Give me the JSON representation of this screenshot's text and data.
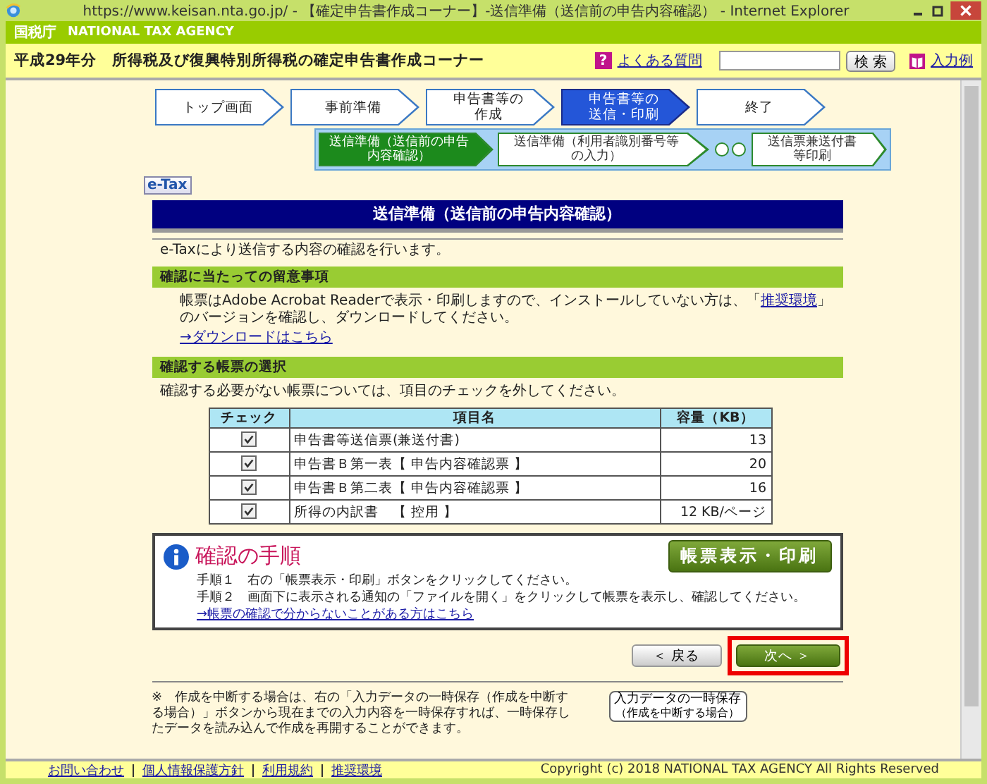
{
  "window": {
    "title": "https://www.keisan.nta.go.jp/ - 【確定申告書作成コーナー】-送信準備（送信前の申告内容確認） - Internet Explorer"
  },
  "agency": {
    "logo": "国税庁",
    "name": "NATIONAL TAX AGENCY"
  },
  "header": {
    "title": "平成29年分　所得税及び復興特別所得税の確定申告書作成コーナー",
    "faq_icon": "?",
    "faq_link": "よくある質問",
    "search_button": "検 索",
    "example_link": "入力例"
  },
  "steps": [
    {
      "lines": [
        "トップ画面"
      ],
      "selected": false
    },
    {
      "lines": [
        "事前準備"
      ],
      "selected": false
    },
    {
      "lines": [
        "申告書等の",
        "作成"
      ],
      "selected": false
    },
    {
      "lines": [
        "申告書等の",
        "送信・印刷"
      ],
      "selected": true
    },
    {
      "lines": [
        "終了"
      ],
      "selected": false
    }
  ],
  "substeps": [
    {
      "lines": [
        "送信準備（送信前の申告",
        "内容確認）"
      ],
      "selected": true
    },
    {
      "lines": [
        "送信準備（利用者識別番号等",
        "の入力）"
      ],
      "selected": false
    },
    {
      "lines": [
        "送信票兼送付書",
        "等印刷"
      ],
      "selected": false
    }
  ],
  "badge": "e-Tax",
  "page_title": "送信準備（送信前の申告内容確認）",
  "intro": "e-Taxにより送信する内容の確認を行います。",
  "notice": {
    "heading": "確認に当たっての留意事項",
    "text_before": "帳票はAdobe Acrobat Readerで表示・印刷しますので、インストールしていない方は、「",
    "link": "推奨環境",
    "text_after": "」のバージョンを確認し、ダウンロードしてください。",
    "download_link": "→ダウンロードはこちら"
  },
  "selection": {
    "heading": "確認する帳票の選択",
    "text": "確認する必要がない帳票については、項目のチェックを外してください。",
    "table": {
      "columns": [
        "チェック",
        "項目名",
        "容量（KB）"
      ],
      "rows": [
        {
          "checked": true,
          "name": "申告書等送信票(兼送付書)",
          "size": "13"
        },
        {
          "checked": true,
          "name": "申告書Ｂ第一表【 申告内容確認票 】",
          "size": "20"
        },
        {
          "checked": true,
          "name": "申告書Ｂ第二表【 申告内容確認票 】",
          "size": "16"
        },
        {
          "checked": true,
          "name": "所得の内訳書　【 控用 】",
          "size": "12 KB/ページ"
        }
      ]
    }
  },
  "procedure": {
    "title": "確認の手順",
    "steps": [
      "手順１　右の「帳票表示・印刷」ボタンをクリックしてください。",
      "手順２　画面下に表示される通知の「ファイルを開く」をクリックして帳票を表示し、確認してください。"
    ],
    "link": "→帳票の確認で分からないことがある方はこちら",
    "button": "帳票表示・印刷"
  },
  "nav": {
    "back": "＜ 戻る",
    "next": "次へ ＞"
  },
  "note": "※　作成を中断する場合は、右の「入力データの一時保存（作成を中断する場合）」ボタンから現在までの入力内容を一時保存すれば、一時保存したデータを読み込んで作成を再開することができます。",
  "save_button": [
    "入力データの一時保存",
    "（作成を中断する場合）"
  ],
  "footer": {
    "links": [
      "お問い合わせ",
      "個人情報保護方針",
      "利用規約",
      "推奨環境"
    ],
    "copyright": "Copyright (c) 2018 NATIONAL TAX AGENCY All Rights Reserved"
  }
}
